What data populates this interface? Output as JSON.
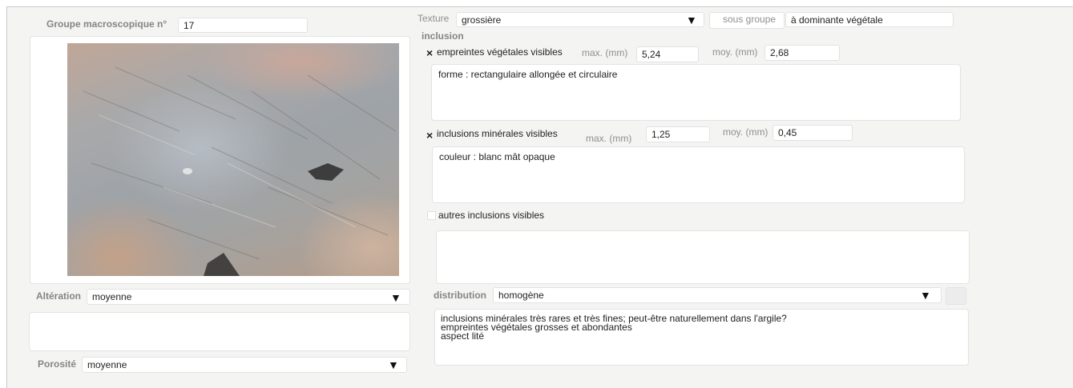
{
  "left": {
    "group_label": "Groupe macroscopique n°",
    "group_number": "17",
    "alteration_label": "Altération",
    "alteration_value": "moyenne",
    "alteration_notes": "",
    "porosite_label": "Porosité",
    "porosite_value": "moyenne"
  },
  "texture": {
    "label": "Texture",
    "value": "grossière",
    "sous_groupe_label": "sous groupe",
    "sous_groupe_value": "à dominante végétale"
  },
  "inclusion": {
    "heading": "inclusion",
    "vegetal": {
      "checked_mark": "×",
      "label": "empreintes végétales visibles",
      "max_label": "max. (mm)",
      "max_value": "5,24",
      "moy_label": "moy. (mm)",
      "moy_value": "2,68",
      "notes": "forme : rectangulaire allongée et circulaire"
    },
    "mineral": {
      "checked_mark": "×",
      "label": "inclusions minérales visibles",
      "max_label": "max. (mm)",
      "max_value": "1,25",
      "moy_label": "moy. (mm)",
      "moy_value": "0,45",
      "notes": "couleur : blanc mât opaque"
    },
    "autres": {
      "label": "autres inclusions visibles",
      "notes": ""
    }
  },
  "distribution": {
    "label": "distribution",
    "value": "homogène"
  },
  "observations": "inclusions minérales très rares et très fines; peut-être naturellement dans l'argile?\nempreintes végétales grosses et abondantes\naspect lité",
  "dropdown_glyph": "▼",
  "icons": [
    "dropdown-arrow-icon",
    "checkbox-checked-icon",
    "checkbox-empty-icon"
  ]
}
